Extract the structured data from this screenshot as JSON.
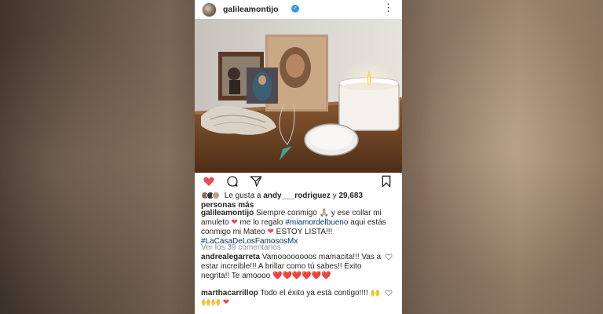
{
  "post": {
    "username": "galileamontijo",
    "more_icon": "more-horizontal-icon"
  },
  "likes": {
    "prefix": "Le gusta a",
    "user": "andy___rodriguez",
    "connector": "y",
    "count": "29,683",
    "suffix": "personas más"
  },
  "caption": {
    "username": "galileamontijo",
    "text1": "Siempre conmigo",
    "emoji1": "🙏🏼",
    "text2": "y ese collar mi amuleto",
    "text3": "me lo regalo",
    "hashtag1": "#miamordelbueno",
    "text4": "aqui estás conmigo mi Mateo",
    "text5": "ESTOY LISTA!!!",
    "hashtag2": "#LaCasaDeLosFamososMx"
  },
  "view_all": "Ver los 39 comentarios",
  "comments": [
    {
      "username": "andrealegarreta",
      "text": "Vamoooooooos mamacita!!! Vas a estar increible!!! A brillar como tú sabes!! Éxito negrita!! Te amoooo",
      "emoji": "❤️❤️❤️❤️❤️❤️"
    },
    {
      "username": "marthacarrillop",
      "text": "Todo el éxito ya está contigo!!!!",
      "emoji": "🙌🙌🙌"
    }
  ],
  "colors": {
    "like_red": "#ed4956",
    "verified_blue": "#3897f0",
    "text": "#262626",
    "muted": "#8e8e8e",
    "hashtag": "#003569"
  }
}
